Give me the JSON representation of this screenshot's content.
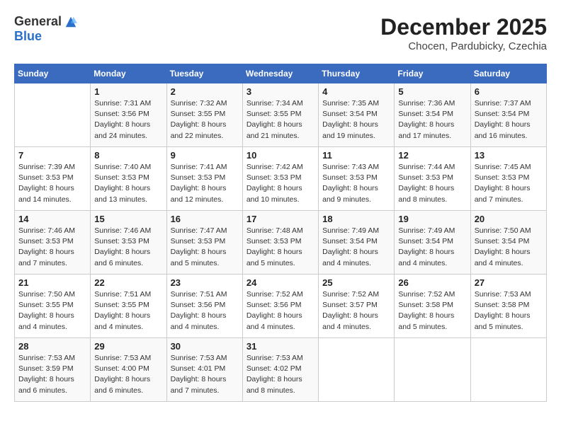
{
  "logo": {
    "general": "General",
    "blue": "Blue"
  },
  "title": "December 2025",
  "subtitle": "Chocen, Pardubicky, Czechia",
  "days_header": [
    "Sunday",
    "Monday",
    "Tuesday",
    "Wednesday",
    "Thursday",
    "Friday",
    "Saturday"
  ],
  "weeks": [
    [
      {
        "num": "",
        "info": ""
      },
      {
        "num": "1",
        "info": "Sunrise: 7:31 AM\nSunset: 3:56 PM\nDaylight: 8 hours\nand 24 minutes."
      },
      {
        "num": "2",
        "info": "Sunrise: 7:32 AM\nSunset: 3:55 PM\nDaylight: 8 hours\nand 22 minutes."
      },
      {
        "num": "3",
        "info": "Sunrise: 7:34 AM\nSunset: 3:55 PM\nDaylight: 8 hours\nand 21 minutes."
      },
      {
        "num": "4",
        "info": "Sunrise: 7:35 AM\nSunset: 3:54 PM\nDaylight: 8 hours\nand 19 minutes."
      },
      {
        "num": "5",
        "info": "Sunrise: 7:36 AM\nSunset: 3:54 PM\nDaylight: 8 hours\nand 17 minutes."
      },
      {
        "num": "6",
        "info": "Sunrise: 7:37 AM\nSunset: 3:54 PM\nDaylight: 8 hours\nand 16 minutes."
      }
    ],
    [
      {
        "num": "7",
        "info": "Sunrise: 7:39 AM\nSunset: 3:53 PM\nDaylight: 8 hours\nand 14 minutes."
      },
      {
        "num": "8",
        "info": "Sunrise: 7:40 AM\nSunset: 3:53 PM\nDaylight: 8 hours\nand 13 minutes."
      },
      {
        "num": "9",
        "info": "Sunrise: 7:41 AM\nSunset: 3:53 PM\nDaylight: 8 hours\nand 12 minutes."
      },
      {
        "num": "10",
        "info": "Sunrise: 7:42 AM\nSunset: 3:53 PM\nDaylight: 8 hours\nand 10 minutes."
      },
      {
        "num": "11",
        "info": "Sunrise: 7:43 AM\nSunset: 3:53 PM\nDaylight: 8 hours\nand 9 minutes."
      },
      {
        "num": "12",
        "info": "Sunrise: 7:44 AM\nSunset: 3:53 PM\nDaylight: 8 hours\nand 8 minutes."
      },
      {
        "num": "13",
        "info": "Sunrise: 7:45 AM\nSunset: 3:53 PM\nDaylight: 8 hours\nand 7 minutes."
      }
    ],
    [
      {
        "num": "14",
        "info": "Sunrise: 7:46 AM\nSunset: 3:53 PM\nDaylight: 8 hours\nand 7 minutes."
      },
      {
        "num": "15",
        "info": "Sunrise: 7:46 AM\nSunset: 3:53 PM\nDaylight: 8 hours\nand 6 minutes."
      },
      {
        "num": "16",
        "info": "Sunrise: 7:47 AM\nSunset: 3:53 PM\nDaylight: 8 hours\nand 5 minutes."
      },
      {
        "num": "17",
        "info": "Sunrise: 7:48 AM\nSunset: 3:53 PM\nDaylight: 8 hours\nand 5 minutes."
      },
      {
        "num": "18",
        "info": "Sunrise: 7:49 AM\nSunset: 3:54 PM\nDaylight: 8 hours\nand 4 minutes."
      },
      {
        "num": "19",
        "info": "Sunrise: 7:49 AM\nSunset: 3:54 PM\nDaylight: 8 hours\nand 4 minutes."
      },
      {
        "num": "20",
        "info": "Sunrise: 7:50 AM\nSunset: 3:54 PM\nDaylight: 8 hours\nand 4 minutes."
      }
    ],
    [
      {
        "num": "21",
        "info": "Sunrise: 7:50 AM\nSunset: 3:55 PM\nDaylight: 8 hours\nand 4 minutes."
      },
      {
        "num": "22",
        "info": "Sunrise: 7:51 AM\nSunset: 3:55 PM\nDaylight: 8 hours\nand 4 minutes."
      },
      {
        "num": "23",
        "info": "Sunrise: 7:51 AM\nSunset: 3:56 PM\nDaylight: 8 hours\nand 4 minutes."
      },
      {
        "num": "24",
        "info": "Sunrise: 7:52 AM\nSunset: 3:56 PM\nDaylight: 8 hours\nand 4 minutes."
      },
      {
        "num": "25",
        "info": "Sunrise: 7:52 AM\nSunset: 3:57 PM\nDaylight: 8 hours\nand 4 minutes."
      },
      {
        "num": "26",
        "info": "Sunrise: 7:52 AM\nSunset: 3:58 PM\nDaylight: 8 hours\nand 5 minutes."
      },
      {
        "num": "27",
        "info": "Sunrise: 7:53 AM\nSunset: 3:58 PM\nDaylight: 8 hours\nand 5 minutes."
      }
    ],
    [
      {
        "num": "28",
        "info": "Sunrise: 7:53 AM\nSunset: 3:59 PM\nDaylight: 8 hours\nand 6 minutes."
      },
      {
        "num": "29",
        "info": "Sunrise: 7:53 AM\nSunset: 4:00 PM\nDaylight: 8 hours\nand 6 minutes."
      },
      {
        "num": "30",
        "info": "Sunrise: 7:53 AM\nSunset: 4:01 PM\nDaylight: 8 hours\nand 7 minutes."
      },
      {
        "num": "31",
        "info": "Sunrise: 7:53 AM\nSunset: 4:02 PM\nDaylight: 8 hours\nand 8 minutes."
      },
      {
        "num": "",
        "info": ""
      },
      {
        "num": "",
        "info": ""
      },
      {
        "num": "",
        "info": ""
      }
    ]
  ]
}
